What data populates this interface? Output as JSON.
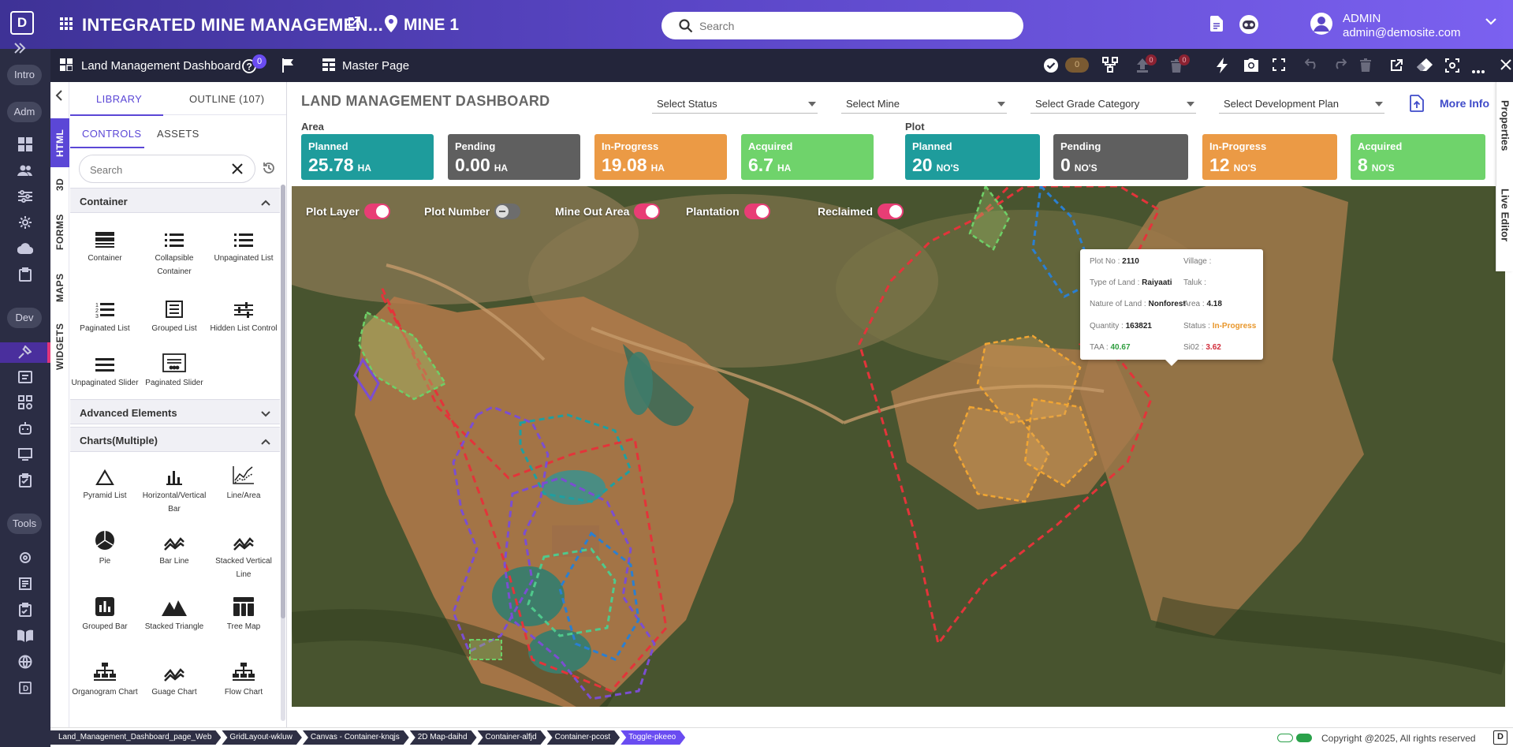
{
  "topbar": {
    "logo": "D",
    "app_title": "INTEGRATED MINE MANAGEMEN...",
    "mine": "MINE 1",
    "search_placeholder": "Search",
    "user_name": "ADMIN",
    "user_email": "admin@demosite.com"
  },
  "rail": {
    "intro": "Intro",
    "adm": "Adm",
    "dev": "Dev",
    "tools": "Tools"
  },
  "subbar": {
    "dashboard_name": "Land Management Dashboard",
    "help_badge": "0",
    "master_page": "Master Page",
    "toggle_value": "0",
    "badge_a": "0",
    "badge_b": "0"
  },
  "panel": {
    "vtabs": [
      "HTML",
      "3D",
      "FORMS",
      "MAPS",
      "WIDGETS"
    ],
    "tab_library": "LIBRARY",
    "tab_outline": "OUTLINE (107)",
    "subtab_controls": "CONTROLS",
    "subtab_assets": "ASSETS",
    "search_placeholder": "Search",
    "sections": {
      "container": "Container",
      "advanced": "Advanced Elements",
      "charts": "Charts(Multiple)"
    },
    "container_items": [
      "Container",
      "Collapsible Container",
      "Unpaginated List",
      "Paginated List",
      "Grouped List",
      "Hidden List Control",
      "Unpaginated Slider",
      "Paginated Slider"
    ],
    "chart_items": [
      "Pyramid List",
      "Horizontal/Vertical Bar",
      "Line/Area",
      "Pie",
      "Bar Line",
      "Stacked Vertical Line",
      "Grouped Bar",
      "Stacked Triangle",
      "Tree Map",
      "Organogram Chart",
      "Guage Chart",
      "Flow Chart"
    ]
  },
  "dashboard": {
    "title": "LAND MANAGEMENT DASHBOARD",
    "filters": [
      "Select Status",
      "Select Mine",
      "Select Grade Category",
      "Select Development Plan"
    ],
    "more_info": "More Info",
    "area_label": "Area",
    "plot_label": "Plot",
    "area_cards": [
      {
        "label": "Planned",
        "value": "25.78",
        "unit": "HA",
        "color": "#1e9c9c"
      },
      {
        "label": "Pending",
        "value": "0.00",
        "unit": "HA",
        "color": "#5f5f5f"
      },
      {
        "label": "In-Progress",
        "value": "19.08",
        "unit": "HA",
        "color": "#eb9a45"
      },
      {
        "label": "Acquired",
        "value": "6.7",
        "unit": "HA",
        "color": "#6fd36b"
      }
    ],
    "plot_cards": [
      {
        "label": "Planned",
        "value": "20",
        "unit": "NO'S",
        "color": "#1e9c9c"
      },
      {
        "label": "Pending",
        "value": "0",
        "unit": "NO'S",
        "color": "#5f5f5f"
      },
      {
        "label": "In-Progress",
        "value": "12",
        "unit": "NO'S",
        "color": "#eb9a45"
      },
      {
        "label": "Acquired",
        "value": "8",
        "unit": "NO'S",
        "color": "#6fd36b"
      }
    ],
    "layers": [
      {
        "label": "Plot Layer",
        "on": true
      },
      {
        "label": "Plot Number",
        "on": false
      },
      {
        "label": "Mine Out Area",
        "on": true
      },
      {
        "label": "Plantation",
        "on": true
      },
      {
        "label": "Reclaimed",
        "on": true
      }
    ],
    "popup": {
      "plot_no_label": "Plot No :",
      "plot_no": "2110",
      "village_label": "Village :",
      "village": "",
      "type_label": "Type of Land :",
      "type": "Raiyaati",
      "taluk_label": "Taluk :",
      "taluk": "",
      "nature_label": "Nature of Land :",
      "nature": "Nonforest",
      "area_label": "Area :",
      "area": "4.18",
      "quantity_label": "Quantity :",
      "quantity": "163821",
      "status_label": "Status :",
      "status": "In-Progress",
      "taa_label": "TAA :",
      "taa": "40.67",
      "sio2_label": "Si02 :",
      "sio2": "3.62"
    }
  },
  "right_tabs": [
    "Properties",
    "Live Editor"
  ],
  "footer": {
    "crumbs": [
      "Land_Management_Dashboard_page_Web",
      "GridLayout-wkluw",
      "Canvas - Container-knqjs",
      "2D Map-daihd",
      "Container-alfjd",
      "Container-pcost",
      "Toggle-pkeeo"
    ],
    "copyright": "Copyright @2025, All rights reserved",
    "logo": "D"
  },
  "colors": {
    "accent": "#5b47d6",
    "rail": "#2b2d44",
    "subbar": "#23253a"
  }
}
